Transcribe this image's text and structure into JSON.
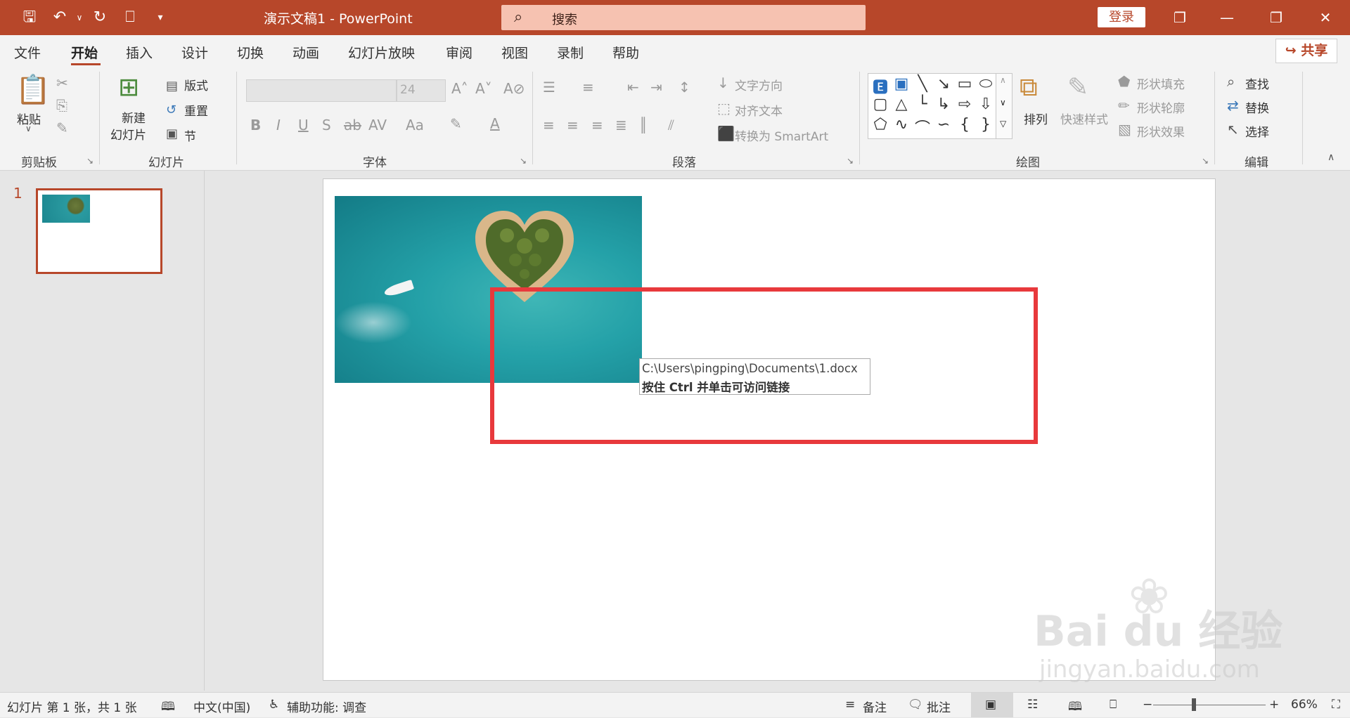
{
  "titlebar": {
    "doc_title": "演示文稿1  -  PowerPoint",
    "search_placeholder": "搜索",
    "login_label": "登录"
  },
  "tabs": [
    "文件",
    "开始",
    "插入",
    "设计",
    "切换",
    "动画",
    "幻灯片放映",
    "审阅",
    "视图",
    "录制",
    "帮助"
  ],
  "active_tab": "开始",
  "share_label": "共享",
  "ribbon": {
    "clipboard": {
      "paste": "粘贴",
      "group": "剪贴板"
    },
    "slides": {
      "new_slide_1": "新建",
      "new_slide_2": "幻灯片",
      "layout": "版式",
      "reset": "重置",
      "section": "节",
      "group": "幻灯片"
    },
    "font": {
      "size": "24",
      "group": "字体"
    },
    "paragraph": {
      "text_direction": "文字方向",
      "align_text": "对齐文本",
      "smartart": "转换为 SmartArt",
      "group": "段落"
    },
    "drawing": {
      "arrange": "排列",
      "quick_styles": "快速样式",
      "shape_fill": "形状填充",
      "shape_outline": "形状轮廓",
      "shape_effects": "形状效果",
      "group": "绘图"
    },
    "editing": {
      "find": "查找",
      "replace": "替换",
      "select": "选择",
      "group": "编辑"
    }
  },
  "thumbs": {
    "slide_number": "1"
  },
  "tooltip": {
    "path": "C:\\Users\\pingping\\Documents\\1.docx",
    "hint": "按住 Ctrl 并单击可访问链接"
  },
  "watermark": {
    "logo": "Bai du 经验",
    "url": "jingyan.baidu.com"
  },
  "statusbar": {
    "slide_info": "幻灯片 第 1 张，共 1 张",
    "language": "中文(中国)",
    "accessibility": "辅助功能: 调查",
    "notes": "备注",
    "comments": "批注",
    "zoom": "66%"
  },
  "colors": {
    "accent": "#b7472a",
    "highlight_box": "#e8393c"
  }
}
